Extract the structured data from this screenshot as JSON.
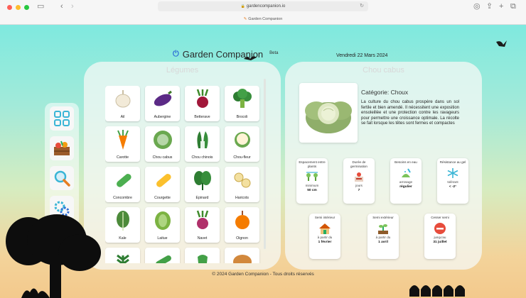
{
  "browser": {
    "url": "gardencompanion.io",
    "tab_title": "Garden Companion"
  },
  "header": {
    "app_name": "Garden Companion",
    "beta": "Beta",
    "date": "Vendredi 22 Mars 2024"
  },
  "legumes_panel": {
    "title": "Légumes",
    "items": [
      {
        "label": "Ail",
        "icon": "garlic-icon"
      },
      {
        "label": "Aubergine",
        "icon": "eggplant-icon"
      },
      {
        "label": "Betterave",
        "icon": "beet-icon"
      },
      {
        "label": "Brocoli",
        "icon": "broccoli-icon"
      },
      {
        "label": "Carotte",
        "icon": "carrot-icon"
      },
      {
        "label": "Chou cabus",
        "icon": "cabbage-icon"
      },
      {
        "label": "Chou chinois",
        "icon": "bokchoy-icon"
      },
      {
        "label": "Chou-fleur",
        "icon": "cauliflower-icon"
      },
      {
        "label": "Concombre",
        "icon": "cucumber-icon"
      },
      {
        "label": "Courgette",
        "icon": "zucchini-icon"
      },
      {
        "label": "Epinard",
        "icon": "spinach-icon"
      },
      {
        "label": "Haricots",
        "icon": "beans-icon"
      },
      {
        "label": "Kale",
        "icon": "kale-icon"
      },
      {
        "label": "Laitue",
        "icon": "lettuce-icon"
      },
      {
        "label": "Navet",
        "icon": "turnip-icon"
      },
      {
        "label": "Oignon",
        "icon": "onion-icon"
      },
      {
        "label": "",
        "icon": "herb-icon"
      },
      {
        "label": "",
        "icon": "pea-pod-icon"
      },
      {
        "label": "",
        "icon": "pepper-icon"
      },
      {
        "label": "",
        "icon": "potato-icon"
      }
    ]
  },
  "detail_panel": {
    "title": "Chou cabus",
    "category": "Catégorie: Choux",
    "description": "La culture du chou cabus prospère dans un sol fertile et bien amendé. Il nécessitent une exposition ensoleillée et une protection contre les ravageurs pour permettre une croissance optimale. La récolte se fait lorsque les têtes sont fermes et compactes",
    "stats": [
      {
        "title": "Espacement entre plants",
        "sub": "minimum",
        "value": "50 cm",
        "icon": "spacing-icon"
      },
      {
        "title": "Durée de germination",
        "sub": "jours",
        "value": "7",
        "icon": "germination-icon"
      },
      {
        "title": "Besoins en eau",
        "sub": "arrosage",
        "value": "régulier",
        "icon": "watering-icon"
      },
      {
        "title": "Résistance au gel",
        "sub": "tolérant",
        "value": "< -2°",
        "icon": "frost-icon"
      }
    ],
    "sowing": [
      {
        "title": "Semi intérieur",
        "sub": "à partir du",
        "value": "1 février",
        "icon": "house-icon"
      },
      {
        "title": "Semi extérieur",
        "sub": "à partir du",
        "value": "1 avril",
        "icon": "sprout-icon"
      },
      {
        "title": "Cesser semi",
        "sub": "jusqu'au",
        "value": "31 juillet",
        "icon": "stop-icon"
      }
    ]
  },
  "footer": "© 2024 Garden Companion - Tous droits réservés",
  "colors": {
    "accent": "#2f6fd6",
    "cyan": "#3ab5d6"
  }
}
